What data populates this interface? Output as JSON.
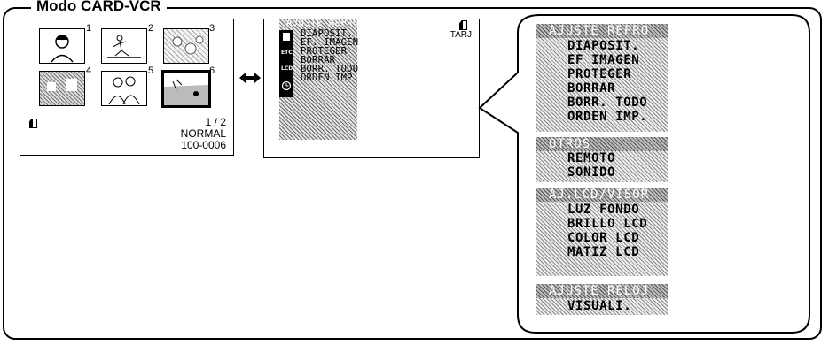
{
  "mode_title": "Modo CARD-VCR",
  "thumbnail_screen": {
    "thumbnails": [
      {
        "number": "1"
      },
      {
        "number": "2"
      },
      {
        "number": "3"
      },
      {
        "number": "4"
      },
      {
        "number": "5"
      },
      {
        "number": "6"
      }
    ],
    "page": "1 / 2",
    "quality": "NORMAL",
    "file_number": "100-0006"
  },
  "menu_screen": {
    "header": "AJUSTE REPRO",
    "media": "TARJ",
    "items": [
      "DIAPOSIT.",
      "EF. IMAGEN",
      "PROTEGER",
      "BORRAR",
      "BORR. TODO",
      "ORDEN IMP."
    ],
    "side_icons": [
      "card-icon",
      "ETC",
      "LCD",
      "clock-icon"
    ]
  },
  "balloon": {
    "groups": [
      {
        "header": "AJUSTE REPRO",
        "items": [
          "DIAPOSIT.",
          "EF IMAGEN",
          "PROTEGER",
          "BORRAR",
          "BORR. TODO",
          "ORDEN IMP."
        ]
      },
      {
        "header": "OTROS",
        "items": [
          "REMOTO",
          "SONIDO"
        ]
      },
      {
        "header": "AJ.LCD/VISOR",
        "items": [
          "LUZ FONDO",
          "BRILLO LCD",
          "COLOR LCD",
          "MATIZ LCD"
        ]
      },
      {
        "header": "AJUSTE RELOJ",
        "items": [
          "VISUALI."
        ]
      }
    ]
  }
}
